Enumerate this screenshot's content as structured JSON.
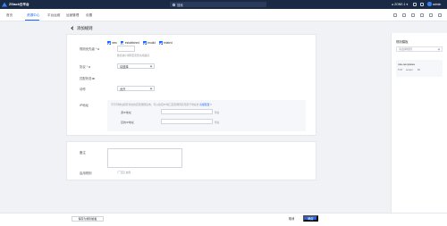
{
  "topbar": {
    "brand": "ZStack云平台",
    "search_placeholder": "搜索",
    "zone": "ZONE-1",
    "user": "admin"
  },
  "nav": {
    "items": [
      "首页",
      "资源中心",
      "平台运维",
      "运营管理",
      "设置"
    ],
    "active_index": 1
  },
  "page": {
    "title": "添加规则"
  },
  "form": {
    "priority_label": "规则优先级",
    "priority_hint": "数值越小规则匹配优先级越高",
    "protocol_label": "协议",
    "protocol_value": "请选择",
    "matching_label": "匹配状态",
    "matching_options": [
      "new",
      "established",
      "invalid",
      "related"
    ],
    "action_label": "动作",
    "action_value": "允许",
    "advanced_label": "IP地址",
    "advanced_desc": "可不同地址和有状态的匹配规则生效，可以指定IP/端口匹配规则实现基于地址的",
    "advanced_link": "高级配置",
    "source_ip_label": "源IP地址",
    "source_ip_note": "例如",
    "dest_ip_label": "目的IP地址",
    "dest_ip_note": "例如"
  },
  "bottom_form": {
    "desc_label": "备注",
    "enable_label": "启用规则",
    "toggle_text": "启用"
  },
  "right_panel": {
    "title": "规则模板",
    "select_placeholder": "请选择规则",
    "card_name": "rule-templates",
    "card_meta": [
      "TCP",
      "accept",
      "80"
    ]
  },
  "footer": {
    "secondary_button": "保存为规则模板",
    "cancel_button": "取消",
    "confirm_button": "确定"
  },
  "colors": {
    "primary": "#1966ff",
    "topbar_bg": "#1a2a45",
    "page_bg": "#f0f2f5"
  }
}
